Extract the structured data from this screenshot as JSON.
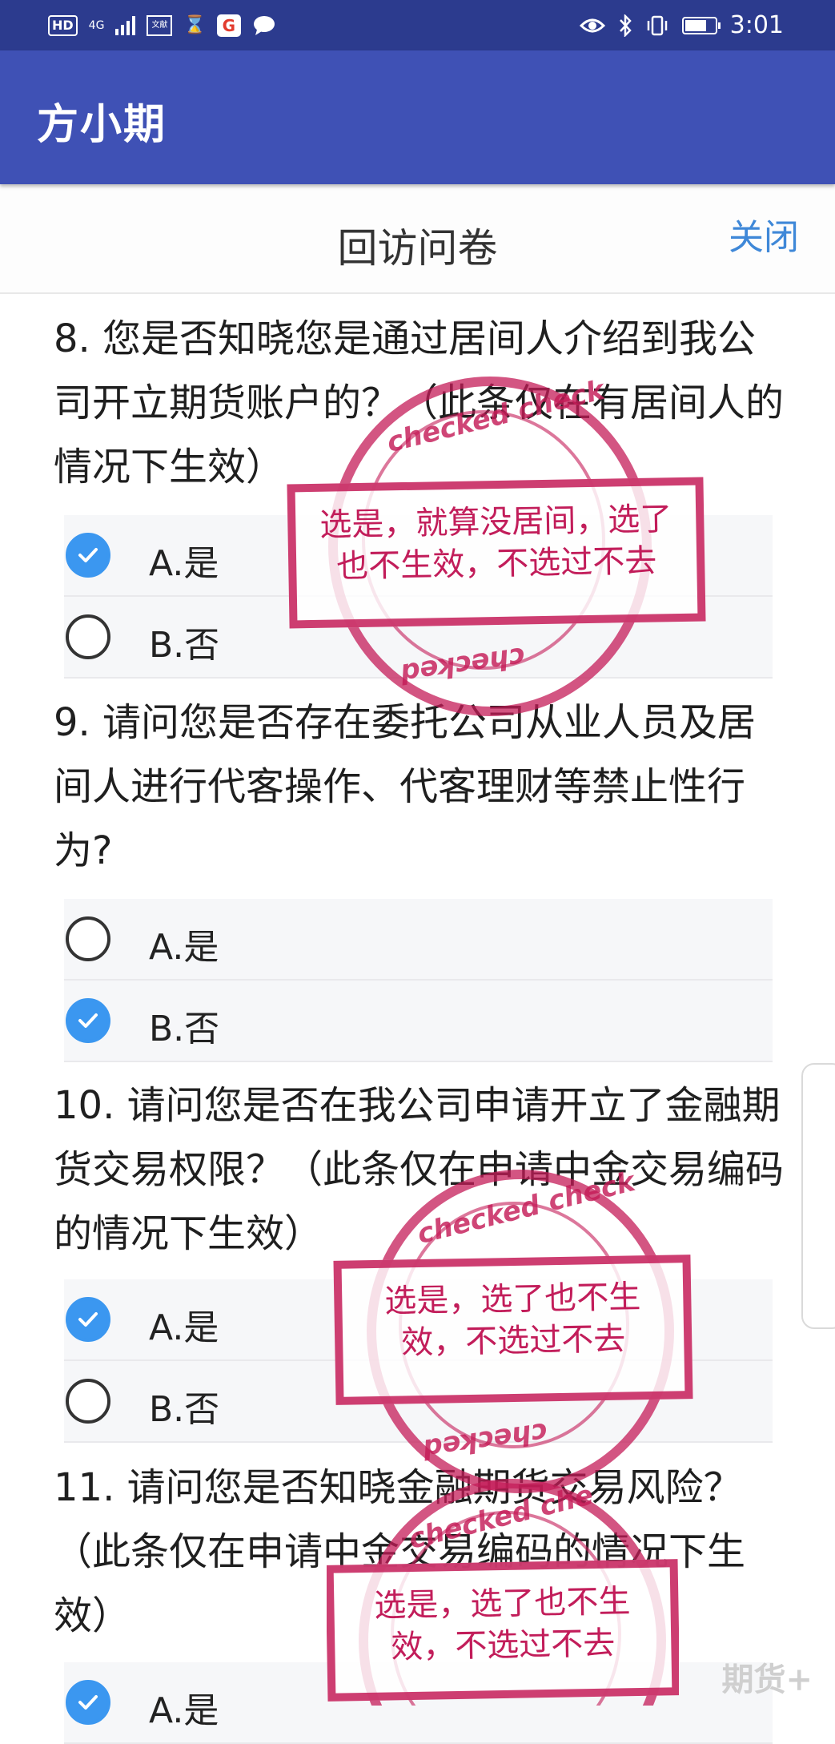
{
  "status_bar": {
    "hd": "HD",
    "network": "4G",
    "network_sub": "46",
    "box_icon_text": "文献",
    "g_icon": "G",
    "time": "3:01"
  },
  "app": {
    "title": "方小期"
  },
  "dialog": {
    "title": "回访问卷",
    "close_label": "关闭"
  },
  "questions": [
    {
      "text": "8. 您是否知晓您是通过居间人介绍到我公司开立期货账户的？（此条仅在有居间人的情况下生效）",
      "options": [
        {
          "label": "A.是",
          "checked": true
        },
        {
          "label": "B.否",
          "checked": false
        }
      ]
    },
    {
      "text": "9. 请问您是否存在委托公司从业人员及居间人进行代客操作、代客理财等禁止性行为?",
      "options": [
        {
          "label": "A.是",
          "checked": false
        },
        {
          "label": "B.否",
          "checked": true
        }
      ]
    },
    {
      "text": "10. 请问您是否在我公司申请开立了金融期货交易权限？（此条仅在申请中金交易编码的情况下生效）",
      "options": [
        {
          "label": "A.是",
          "checked": true
        },
        {
          "label": "B.否",
          "checked": false
        }
      ]
    },
    {
      "text": "11. 请问您是否知晓金融期货交易风险？（此条仅在申请中金交易编码的情况下生效）",
      "options": [
        {
          "label": "A.是",
          "checked": true
        }
      ]
    }
  ],
  "stamps": [
    {
      "ring_text_top": "checked  check",
      "ring_text_bottom": "checked",
      "note_line1": "选是，就算没居间，选了",
      "note_line2": "也不生效，不选过不去"
    },
    {
      "ring_text_top": "checked  check",
      "ring_text_bottom": "checked",
      "note_line1": "选是，选了也不生",
      "note_line2": "效，不选过不去"
    },
    {
      "ring_text_top": "checked  che",
      "note_line1": "选是，选了也不生",
      "note_line2": "效，不选过不去"
    }
  ],
  "watermark": "期货+",
  "colors": {
    "status_bar": "#2c3b8e",
    "app_bar": "#3f51b5",
    "accent": "#3b97f0",
    "link": "#3f88d8",
    "stamp": "#c21d5a"
  }
}
